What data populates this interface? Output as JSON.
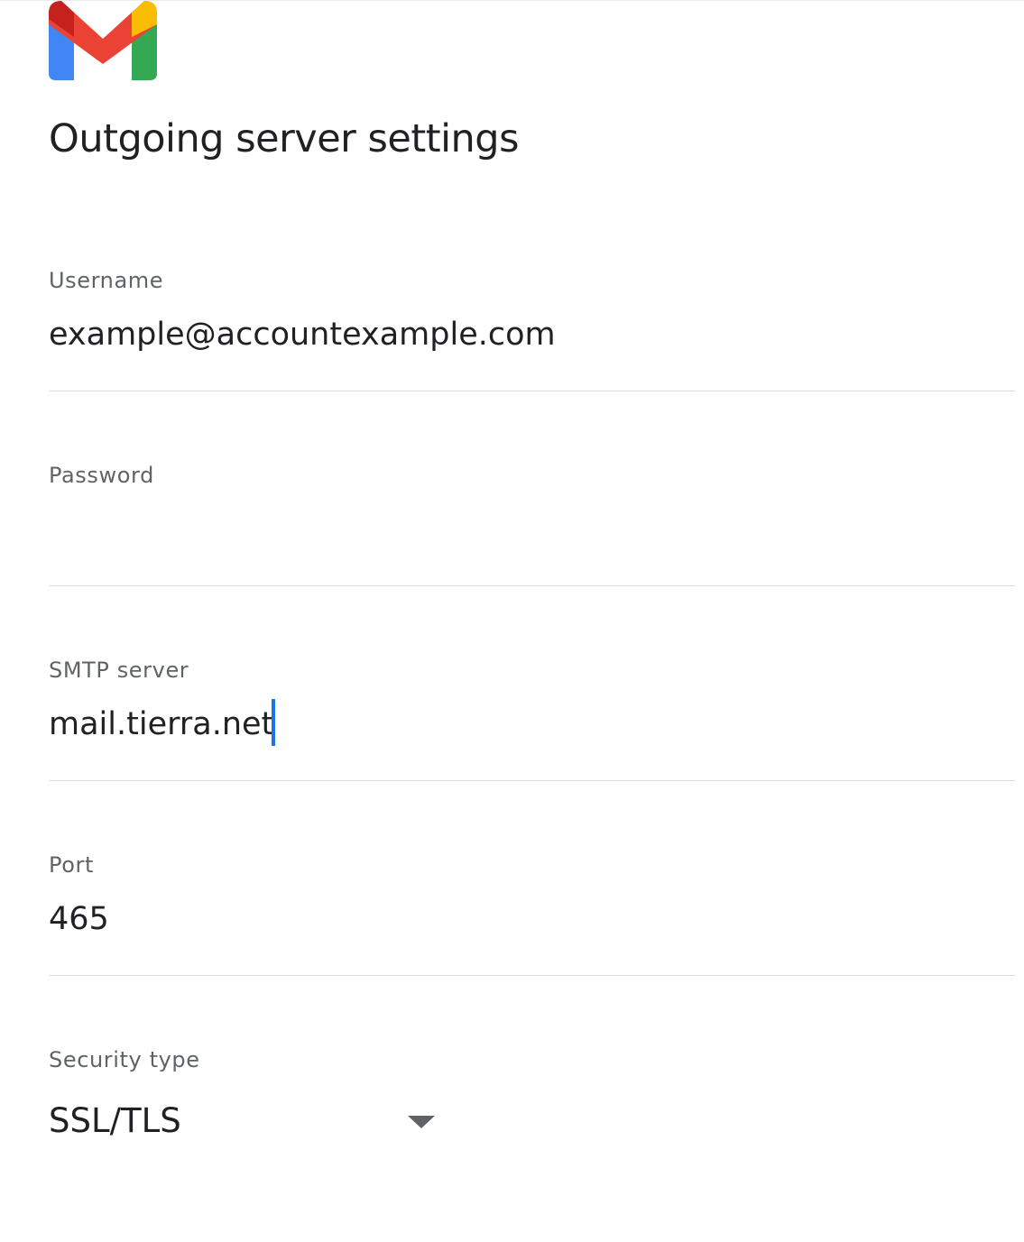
{
  "app": {
    "logo_icon": "gmail-logo-icon",
    "title": "Outgoing server settings"
  },
  "fields": [
    {
      "label": "Username",
      "value": "example@accountexample.com",
      "type": "text"
    },
    {
      "label": "Password",
      "value": "",
      "type": "password"
    },
    {
      "label": "SMTP server",
      "value": "mail.tierra.net",
      "type": "text",
      "focused": true
    },
    {
      "label": "Port",
      "value": "465",
      "type": "text"
    }
  ],
  "security": {
    "label": "Security type",
    "selected": "SSL/TLS",
    "arrow_icon": "dropdown-arrow-icon"
  },
  "colors": {
    "caret": "#1a73e8",
    "label": "#5f6368",
    "text": "#202124",
    "divider": "#dadce0",
    "logo_red": "#ea4335",
    "logo_blue": "#4285f4",
    "logo_green": "#34a853",
    "logo_yellow": "#fbbc04",
    "logo_dark_red": "#c5221f"
  }
}
